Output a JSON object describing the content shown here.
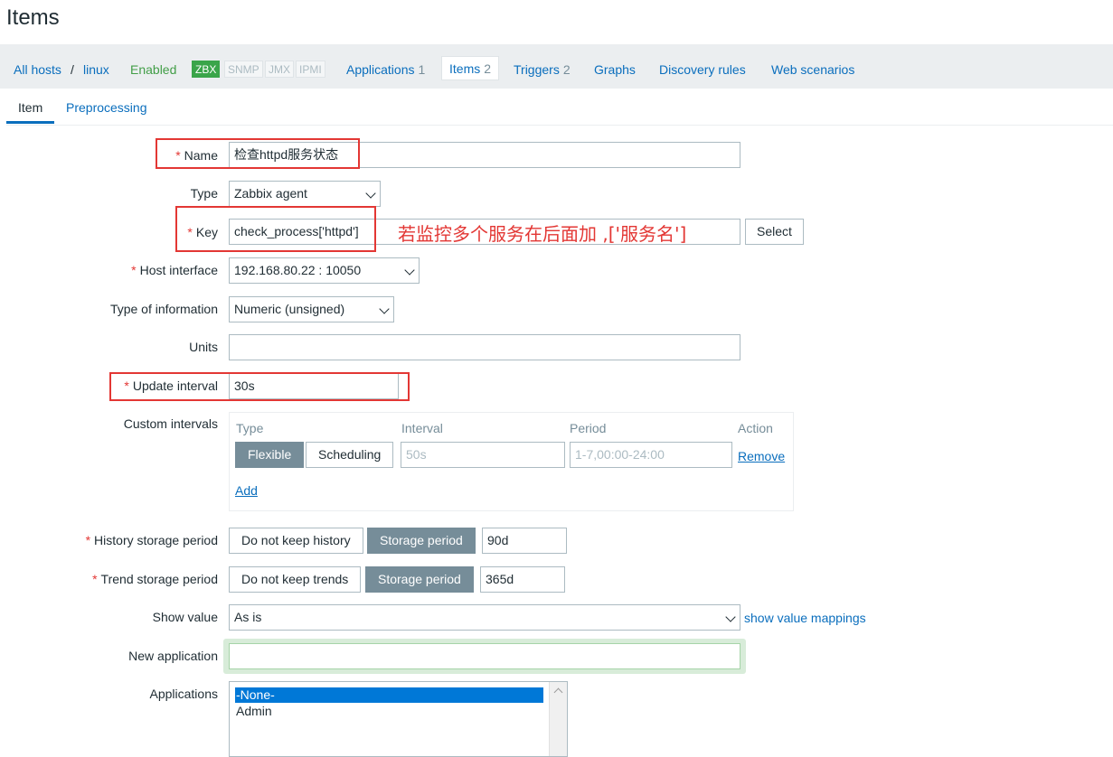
{
  "page": {
    "title": "Items"
  },
  "nav": {
    "all_hosts": "All hosts",
    "separator": "/",
    "host": "linux",
    "status": "Enabled",
    "availability": [
      "ZBX",
      "SNMP",
      "JMX",
      "IPMI"
    ],
    "applications": {
      "label": "Applications",
      "count": "1"
    },
    "items": {
      "label": "Items",
      "count": "2"
    },
    "triggers": {
      "label": "Triggers",
      "count": "2"
    },
    "graphs": "Graphs",
    "discovery": "Discovery rules",
    "web": "Web scenarios"
  },
  "subtabs": {
    "item": "Item",
    "preprocessing": "Preprocessing"
  },
  "form": {
    "required_mark": "*",
    "name": {
      "label": "Name",
      "value": "检查httpd服务状态"
    },
    "type": {
      "label": "Type",
      "value": "Zabbix agent"
    },
    "key": {
      "label": "Key",
      "value": "check_process['httpd']",
      "select_label": "Select"
    },
    "host_interface": {
      "label": "Host interface",
      "value": "192.168.80.22 : 10050"
    },
    "type_of_information": {
      "label": "Type of information",
      "value": "Numeric (unsigned)"
    },
    "units": {
      "label": "Units",
      "value": ""
    },
    "update_interval": {
      "label": "Update interval",
      "value": "30s"
    },
    "custom_intervals": {
      "label": "Custom intervals",
      "headers": [
        "Type",
        "Interval",
        "Period",
        "Action"
      ],
      "type_options": [
        "Flexible",
        "Scheduling"
      ],
      "interval_placeholder": "50s",
      "period_placeholder": "1-7,00:00-24:00",
      "remove": "Remove",
      "add": "Add"
    },
    "history": {
      "label": "History storage period",
      "options": [
        "Do not keep history",
        "Storage period"
      ],
      "value": "90d"
    },
    "trend": {
      "label": "Trend storage period",
      "options": [
        "Do not keep trends",
        "Storage period"
      ],
      "value": "365d"
    },
    "show_value": {
      "label": "Show value",
      "value": "As is",
      "link": "show value mappings"
    },
    "new_application": {
      "label": "New application",
      "value": ""
    },
    "applications": {
      "label": "Applications",
      "options": [
        "-None-",
        "Admin"
      ]
    }
  },
  "annotation": "若监控多个服务在后面加 ,['服务名']",
  "colors": {
    "accent": "#0a6ebd",
    "required": "#e33734",
    "enabled": "#429e47",
    "highlight": "#e33734"
  }
}
